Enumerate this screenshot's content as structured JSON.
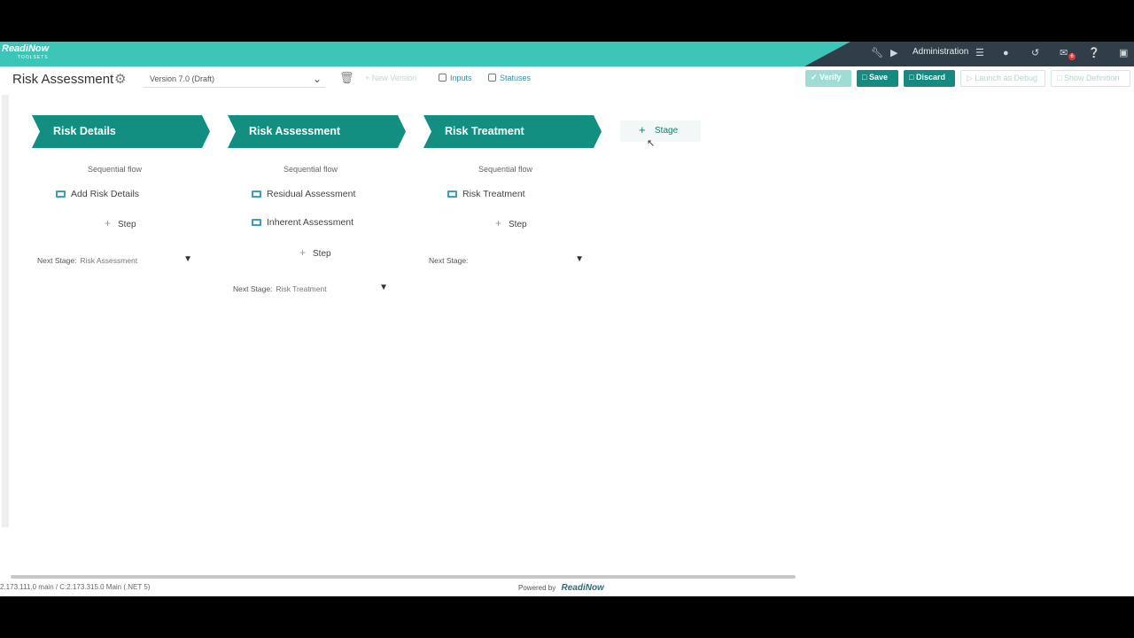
{
  "app": {
    "logo": "ReadiNow",
    "logo_sub": "TOOLSETS"
  },
  "topbar": {
    "admin_label": "Administration",
    "notification_count": "6",
    "icons": [
      "wrench-icon",
      "play-icon",
      "menu-icon",
      "user-icon",
      "history-icon",
      "notifications-icon",
      "help-icon",
      "window-icon"
    ]
  },
  "toolbar": {
    "title": "Risk Assessment",
    "version": "Version 7.0 (Draft)",
    "new_version": "New Version",
    "inputs": "Inputs",
    "statuses": "Statuses",
    "verify": "Verify",
    "save": "Save",
    "discard": "Discard",
    "launch_debug": "Launch as Debug",
    "show_definition": "Show Definition"
  },
  "stages": [
    {
      "name": "Risk Details",
      "flow": "Sequential flow",
      "steps": [
        "Add Risk Details"
      ],
      "add_step": "Step",
      "next_label": "Next Stage:",
      "next_value": "Risk Assessment"
    },
    {
      "name": "Risk Assessment",
      "flow": "Sequential flow",
      "steps": [
        "Residual Assessment",
        "Inherent Assessment"
      ],
      "add_step": "Step",
      "next_label": "Next Stage:",
      "next_value": "Risk Treatment"
    },
    {
      "name": "Risk Treatment",
      "flow": "Sequential flow",
      "steps": [
        "Risk Treatment"
      ],
      "add_step": "Step",
      "next_label": "Next Stage:",
      "next_value": ""
    }
  ],
  "add_stage": "Stage",
  "footer": {
    "version_info": "2.173.111.0 main / C:2.173.315.0 Main (.NET 5)",
    "powered_by": "Powered by",
    "brand": "ReadiNow"
  },
  "colors": {
    "topbar": "#3bc6b8",
    "stage": "#138f82",
    "button": "#168a80",
    "dark": "#2f3e48"
  }
}
